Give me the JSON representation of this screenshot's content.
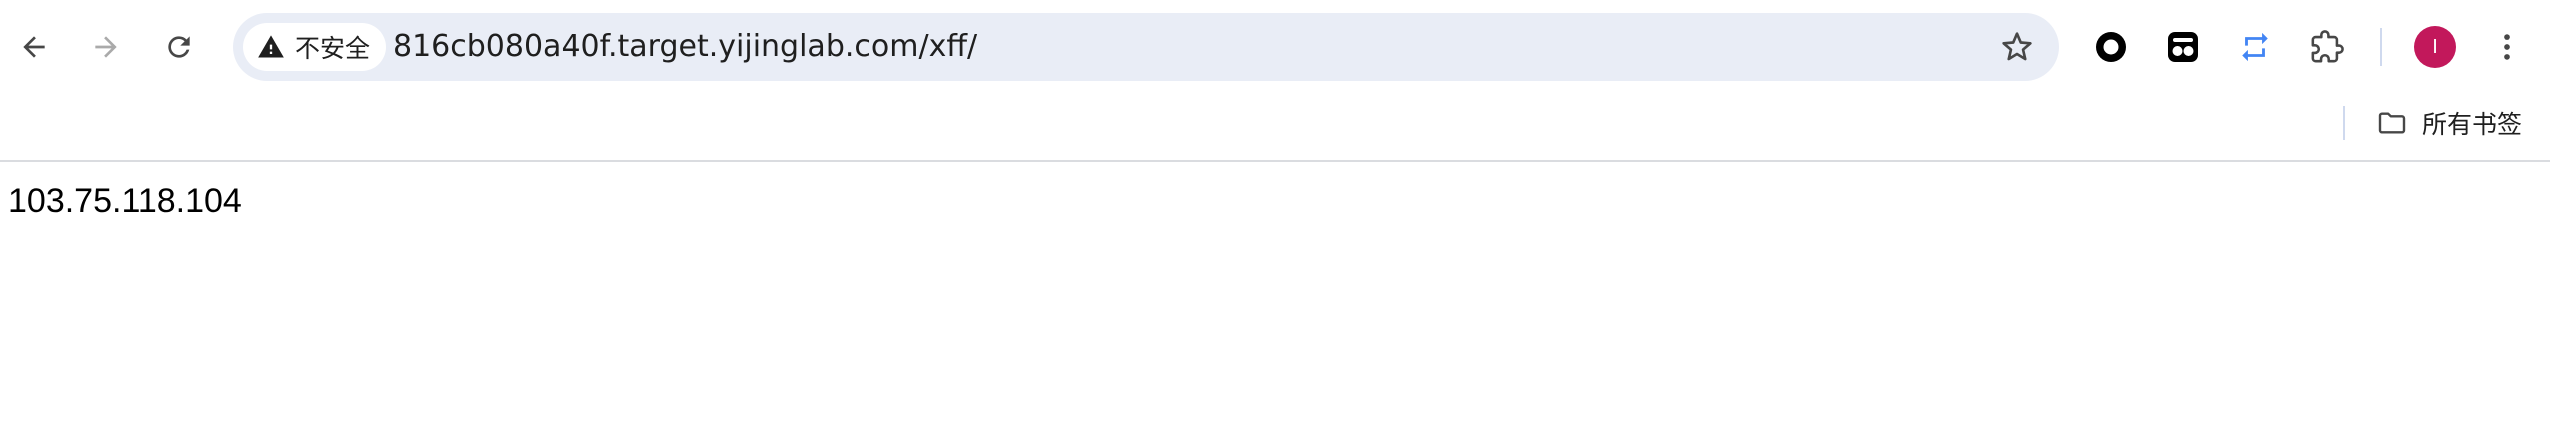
{
  "browser": {
    "security_label": "不安全",
    "url": "816cb080a40f.target.yijinglab.com/xff/",
    "profile_initial": "I",
    "profile_color": "#c2185b",
    "icons": {
      "back": "arrow-left-icon",
      "forward": "arrow-right-icon",
      "reload": "reload-icon",
      "security": "warning-triangle-icon",
      "bookmark": "star-icon",
      "extensions": [
        "circle-record-icon",
        "theater-mask-icon",
        "sync-arrows-icon",
        "puzzle-piece-icon"
      ],
      "menu": "kebab-menu-icon"
    }
  },
  "bookmarks_bar": {
    "folder_label": "所有书签",
    "folder_icon": "folder-icon"
  },
  "page": {
    "body_text": "103.75.118.104"
  }
}
